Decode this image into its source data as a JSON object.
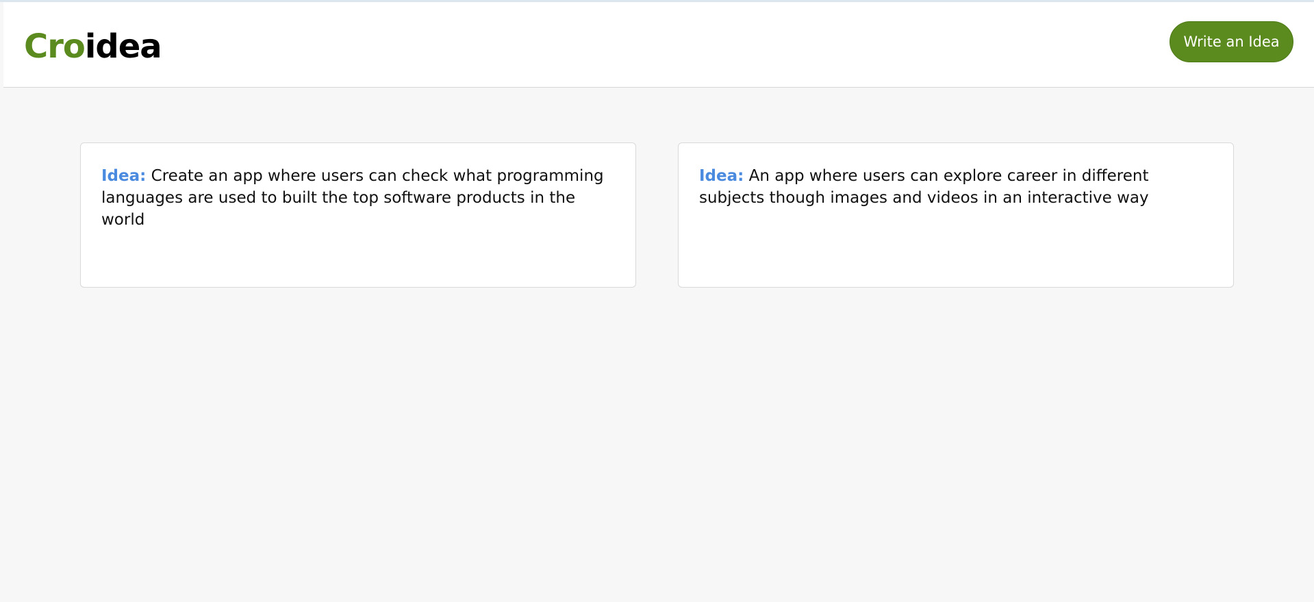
{
  "header": {
    "logo_part_green": "Cro",
    "logo_part_black": "idea",
    "write_button_label": "Write an Idea"
  },
  "colors": {
    "brand_green": "#5b8a1f",
    "idea_label_blue": "#4a8be0",
    "background": "#f7f7f7"
  },
  "ideas": [
    {
      "label": "Idea:",
      "text": "Create an app where users can check what programming languages are used to built the top software products in the world"
    },
    {
      "label": "Idea:",
      "text": "An app where users can explore career in different subjects though images and videos in an interactive way"
    }
  ]
}
